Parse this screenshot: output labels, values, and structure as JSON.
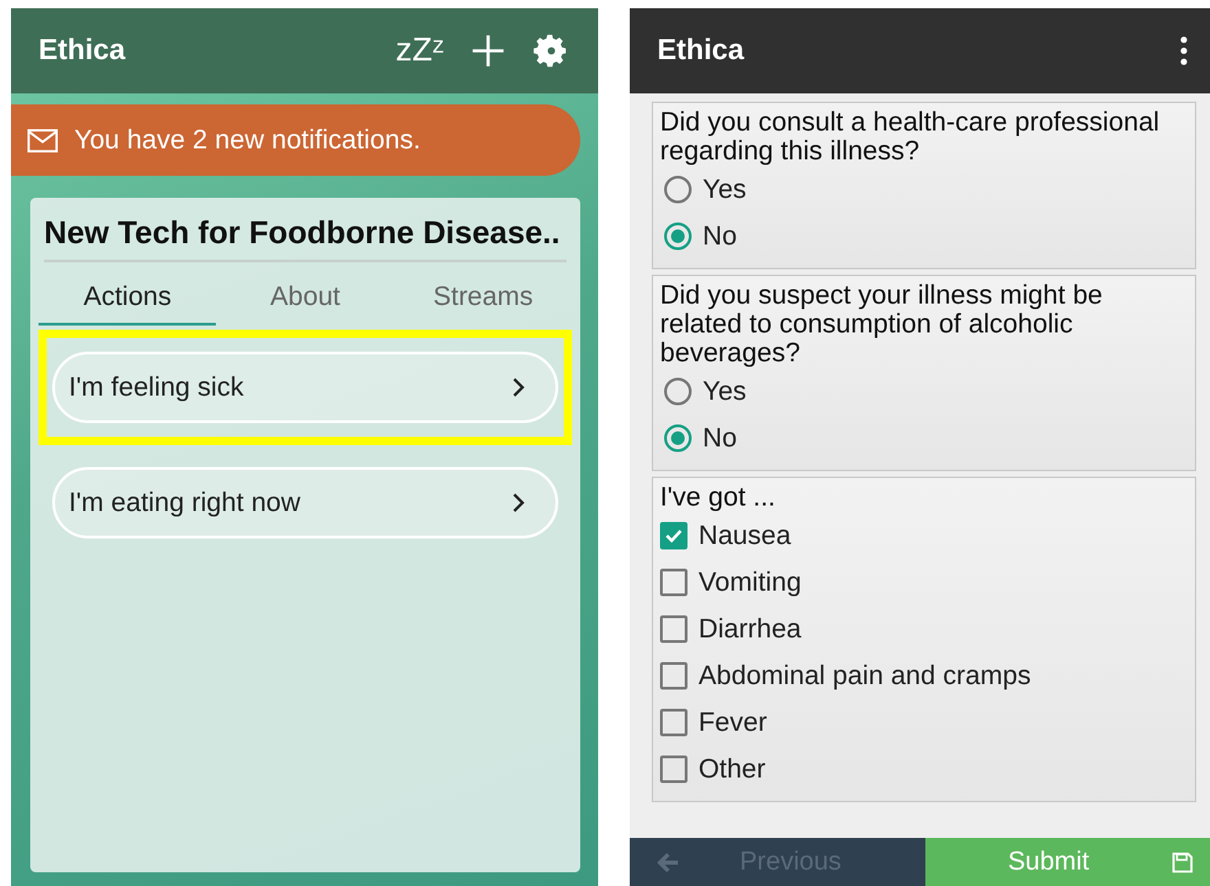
{
  "left_screen": {
    "app_bar": {
      "title": "Ethica",
      "snooze_label": "zZᶻ"
    },
    "notification": {
      "text": "You have 2 new notifications."
    },
    "study_card": {
      "title": "New Tech for Foodborne Disease..",
      "tabs": [
        {
          "label": "Actions",
          "selected": true
        },
        {
          "label": "About",
          "selected": false
        },
        {
          "label": "Streams",
          "selected": false
        }
      ],
      "actions": [
        {
          "label": "I'm feeling sick",
          "highlighted": true
        },
        {
          "label": "I'm eating right now",
          "highlighted": false
        }
      ]
    }
  },
  "right_screen": {
    "app_bar": {
      "title": "Ethica"
    },
    "questions": [
      {
        "kind": "radio",
        "prompt": "Did you consult a health-care professional regarding this illness?",
        "options": [
          {
            "label": "Yes",
            "selected": false
          },
          {
            "label": "No",
            "selected": true
          }
        ]
      },
      {
        "kind": "radio",
        "prompt": "Did you suspect your illness might be related to consumption of alcoholic beverages?",
        "options": [
          {
            "label": "Yes",
            "selected": false
          },
          {
            "label": "No",
            "selected": true
          }
        ]
      },
      {
        "kind": "checkbox",
        "prompt": "I've got ...",
        "options": [
          {
            "label": "Nausea",
            "checked": true
          },
          {
            "label": "Vomiting",
            "checked": false
          },
          {
            "label": "Diarrhea",
            "checked": false
          },
          {
            "label": "Abdominal pain and cramps",
            "checked": false
          },
          {
            "label": "Fever",
            "checked": false
          },
          {
            "label": "Other",
            "checked": false
          }
        ]
      }
    ],
    "footer": {
      "previous": {
        "label": "Previous",
        "disabled": true
      },
      "submit": {
        "label": "Submit",
        "disabled": false
      }
    }
  }
}
